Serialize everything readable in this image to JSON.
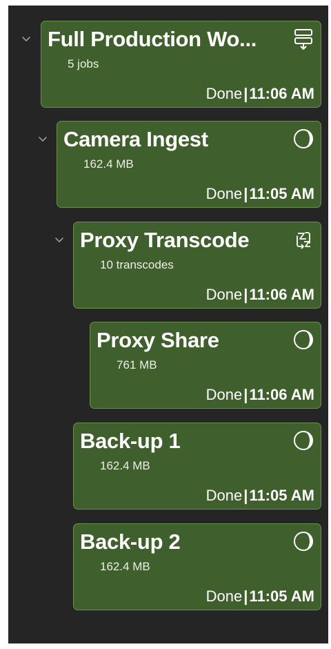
{
  "jobs": [
    {
      "title": "Full Production Wo...",
      "subtitle": "5 jobs",
      "status": "Done",
      "separator": "|",
      "time": "11:06 AM",
      "icon": "workflow-icon",
      "expanded": true
    },
    {
      "title": "Camera Ingest",
      "subtitle": "162.4 MB",
      "status": "Done",
      "separator": "|",
      "time": "11:05 AM",
      "icon": "complete-circle-icon",
      "expanded": true
    },
    {
      "title": "Proxy Transcode",
      "subtitle": "10 transcodes",
      "status": "Done",
      "separator": "|",
      "time": "11:06 AM",
      "icon": "transcode-icon",
      "expanded": true
    },
    {
      "title": "Proxy Share",
      "subtitle": "761 MB",
      "status": "Done",
      "separator": "|",
      "time": "11:06 AM",
      "icon": "complete-circle-icon"
    },
    {
      "title": "Back-up 1",
      "subtitle": "162.4 MB",
      "status": "Done",
      "separator": "|",
      "time": "11:05 AM",
      "icon": "complete-circle-icon"
    },
    {
      "title": "Back-up 2",
      "subtitle": "162.4 MB",
      "status": "Done",
      "separator": "|",
      "time": "11:05 AM",
      "icon": "complete-circle-icon"
    }
  ]
}
